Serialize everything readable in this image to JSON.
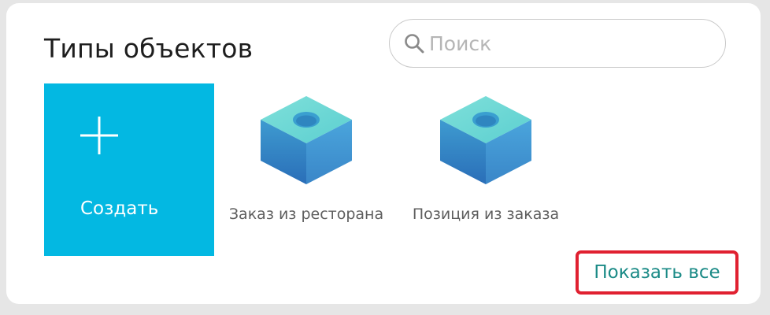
{
  "header": {
    "title": "Типы объектов"
  },
  "search": {
    "placeholder": "Поиск",
    "value": "",
    "icon": "search-icon"
  },
  "create": {
    "label": "Создать",
    "icon": "plus-icon",
    "color": "#03b8e2"
  },
  "objects": [
    {
      "label": "Заказ из ресторана",
      "icon": "cube-icon"
    },
    {
      "label": "Позиция из заказа",
      "icon": "cube-icon"
    }
  ],
  "footer": {
    "show_all_label": "Показать все",
    "highlight_color": "#e02030"
  }
}
